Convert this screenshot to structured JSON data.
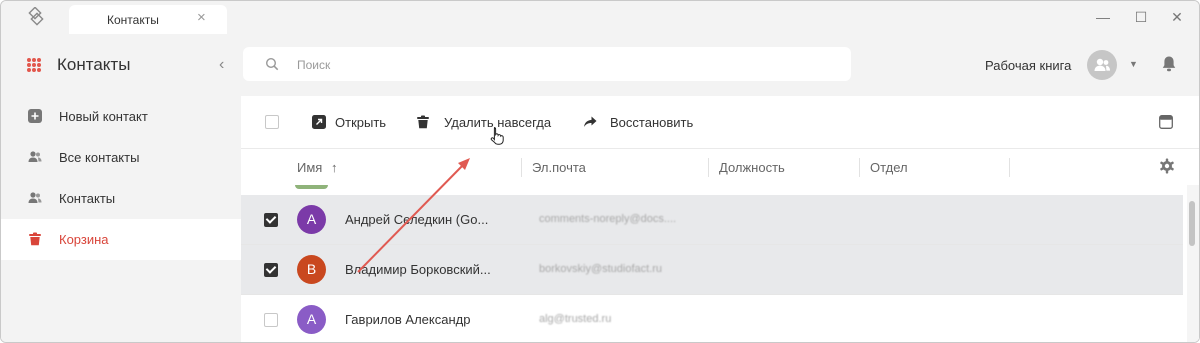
{
  "titlebar": {
    "tab_label": "Контакты",
    "tab_close": "×",
    "minimize": "—",
    "maximize": "☐",
    "close": "✕"
  },
  "sidebar": {
    "title": "Контакты",
    "collapse": "‹",
    "items": [
      {
        "label": "Новый контакт",
        "icon": "plus-square-icon"
      },
      {
        "label": "Все контакты",
        "icon": "users-icon"
      },
      {
        "label": "Контакты",
        "icon": "users-icon"
      },
      {
        "label": "Корзина",
        "icon": "trash-icon",
        "active": true
      }
    ]
  },
  "search": {
    "placeholder": "Поиск"
  },
  "header": {
    "workbook": "Рабочая книга",
    "avatar_caret": "▼"
  },
  "toolbar": {
    "open": "Открыть",
    "delete_forever": "Удалить навсегда",
    "restore": "Восстановить"
  },
  "table": {
    "columns": [
      "Имя",
      "Эл.почта",
      "Должность",
      "Отдел"
    ],
    "sort_indicator": "↑",
    "rows": [
      {
        "initial": "А",
        "name": "Андрей Селедкин (Go...",
        "email": "comments-noreply@docs....",
        "selected": true,
        "color": "#7b3aa8"
      },
      {
        "initial": "В",
        "name": "Владимир Борковский...",
        "email": "borkovskiy@studiofact.ru",
        "selected": true,
        "color": "#c9481f"
      },
      {
        "initial": "А",
        "name": "Гаврилов Александр",
        "email": "alg@trusted.ru",
        "selected": false,
        "color": "#8a5cc6"
      }
    ]
  },
  "colors": {
    "accent": "#d9453a",
    "annotation_arrow": "#e05a52"
  }
}
